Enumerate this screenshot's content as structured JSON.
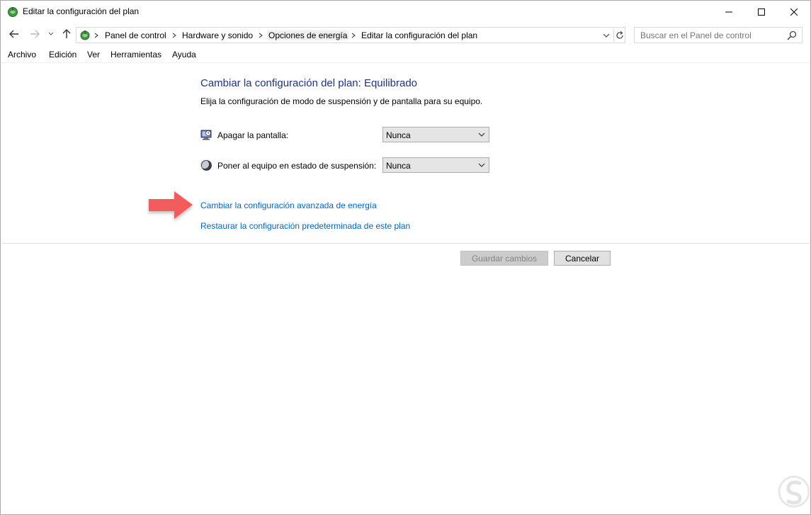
{
  "window": {
    "title": "Editar la configuración del plan"
  },
  "address": {
    "crumbs": [
      "Panel de control",
      "Hardware y sonido",
      "Opciones de energía",
      "Editar la configuración del plan"
    ]
  },
  "search": {
    "placeholder": "Buscar en el Panel de control"
  },
  "menu": {
    "items": [
      "Archivo",
      "Edición",
      "Ver",
      "Herramientas",
      "Ayuda"
    ]
  },
  "main": {
    "heading": "Cambiar la configuración del plan: Equilibrado",
    "description": "Elija la configuración de modo de suspensión y de pantalla para su equipo.",
    "settings": [
      {
        "label": "Apagar la pantalla:",
        "value": "Nunca",
        "icon": "monitor-clock-icon"
      },
      {
        "label": "Poner al equipo en estado de suspensión:",
        "value": "Nunca",
        "icon": "moon-icon"
      }
    ],
    "links": {
      "advanced": "Cambiar la configuración avanzada de energía",
      "restore": "Restaurar la configuración predeterminada de este plan"
    }
  },
  "footer": {
    "save_label": "Guardar cambios",
    "cancel_label": "Cancelar"
  },
  "colors": {
    "heading": "#1e3287",
    "link": "#0066cc",
    "arrow_annotation": "#f25c5c"
  }
}
